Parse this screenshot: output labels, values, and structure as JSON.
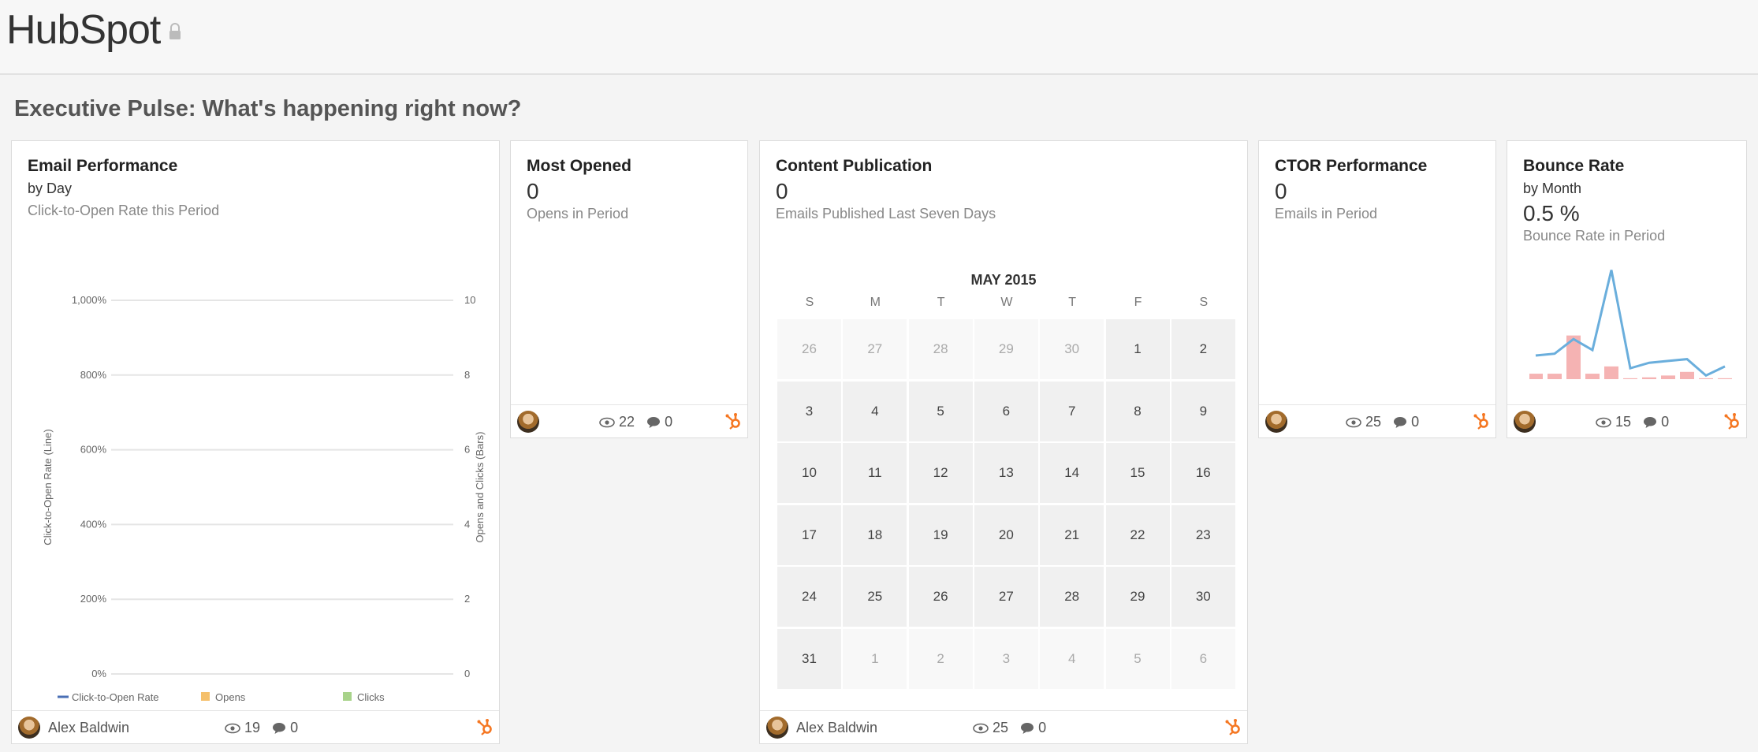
{
  "app": {
    "brand": "HubSpot"
  },
  "section_title": "Executive Pulse: What's happening right now?",
  "cards": {
    "email_performance": {
      "title": "Email Performance",
      "subtitle": "by Day",
      "caption": "Click-to-Open Rate this Period",
      "author": "Alex Baldwin",
      "views": "19",
      "comments": "0"
    },
    "most_opened": {
      "title": "Most Opened",
      "metric": "0",
      "caption": "Opens in Period",
      "views": "22",
      "comments": "0"
    },
    "content_publication": {
      "title": "Content Publication",
      "metric": "0",
      "caption": "Emails Published Last Seven Days",
      "author": "Alex Baldwin",
      "views": "25",
      "comments": "0",
      "calendar": {
        "month_label": "MAY 2015",
        "weekdays": [
          "S",
          "M",
          "T",
          "W",
          "T",
          "F",
          "S"
        ],
        "weeks": [
          [
            "26",
            "27",
            "28",
            "29",
            "30",
            "1",
            "2"
          ],
          [
            "3",
            "4",
            "5",
            "6",
            "7",
            "8",
            "9"
          ],
          [
            "10",
            "11",
            "12",
            "13",
            "14",
            "15",
            "16"
          ],
          [
            "17",
            "18",
            "19",
            "20",
            "21",
            "22",
            "23"
          ],
          [
            "24",
            "25",
            "26",
            "27",
            "28",
            "29",
            "30"
          ],
          [
            "31",
            "1",
            "2",
            "3",
            "4",
            "5",
            "6"
          ]
        ]
      }
    },
    "ctor_performance": {
      "title": "CTOR Performance",
      "metric": "0",
      "caption": "Emails in Period",
      "views": "25",
      "comments": "0"
    },
    "bounce_rate": {
      "title": "Bounce Rate",
      "subtitle": "by Month",
      "metric": "0.5 %",
      "caption": "Bounce Rate in Period",
      "views": "15",
      "comments": "0"
    }
  },
  "colors": {
    "ctor_line": "#4a6fb5",
    "opens_bar": "#f5c06b",
    "clicks_bar": "#a8d38a",
    "spark_line": "#6aaedc",
    "spark_bar": "#f5b3b3",
    "hubspot_orange": "#f57722"
  },
  "chart_data": [
    {
      "type": "line",
      "title": "",
      "ylabel": "Click-to-Open Rate (Line)",
      "y2label": "Opens and Clicks (Bars)",
      "y_ticks": [
        "0%",
        "200%",
        "400%",
        "600%",
        "800%",
        "1,000%"
      ],
      "ylim": [
        0,
        1000
      ],
      "y2_ticks": [
        "0",
        "2",
        "4",
        "6",
        "8",
        "10"
      ],
      "y2lim": [
        0,
        10
      ],
      "grid": true,
      "legend_position": "bottom",
      "series": [
        {
          "name": "Click-to-Open Rate",
          "values": []
        },
        {
          "name": "Opens",
          "values": []
        },
        {
          "name": "Clicks",
          "values": []
        }
      ]
    },
    {
      "type": "bar",
      "title": "",
      "bars": [
        0.3,
        0.3,
        2.4,
        0.3,
        0.7,
        0.05,
        0.1,
        0.2,
        0.4,
        0.05,
        0.05
      ],
      "line": [
        1.3,
        1.4,
        2.2,
        1.6,
        6.0,
        0.6,
        0.9,
        1.0,
        1.1,
        0.2,
        0.7
      ],
      "ylim": [
        0,
        6.5
      ]
    }
  ]
}
